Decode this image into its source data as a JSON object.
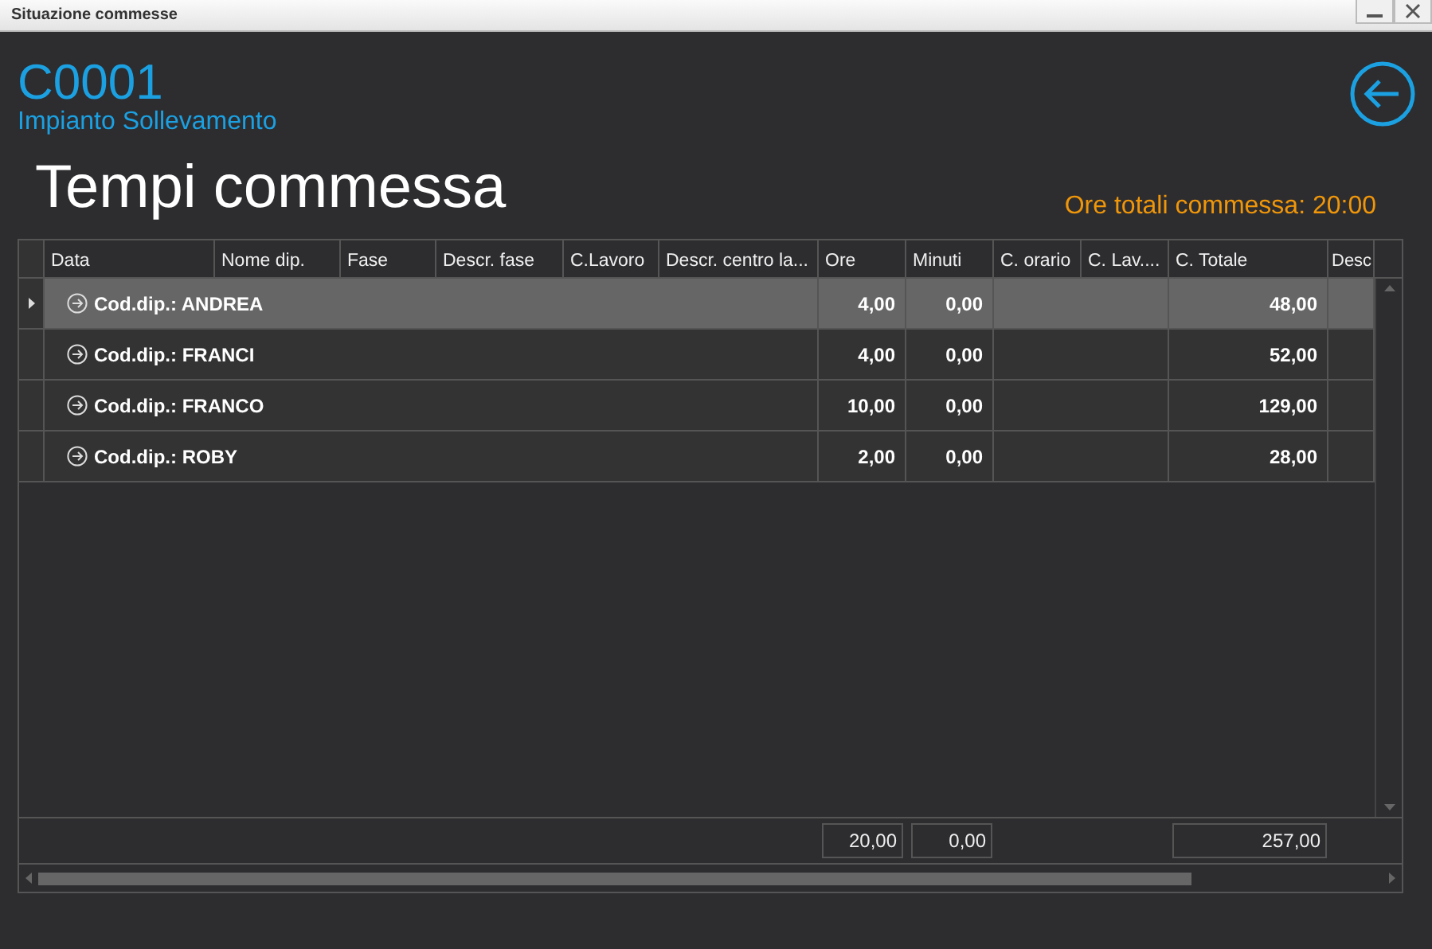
{
  "window": {
    "title": "Situazione commesse"
  },
  "header": {
    "code": "C0001",
    "description": "Impianto Sollevamento"
  },
  "section_title": "Tempi commessa",
  "total_label": "Ore totali commessa: 20:00",
  "table": {
    "columns": [
      "Data",
      "Nome dip.",
      "Fase",
      "Descr. fase",
      "C.Lavoro",
      "Descr. centro la...",
      "Ore",
      "Minuti",
      "C. orario",
      "C. Lav....",
      "C. Totale",
      "Desc"
    ],
    "rows": [
      {
        "label": "Cod.dip.: ANDREA",
        "ore": "4,00",
        "minuti": "0,00",
        "c_totale": "48,00",
        "selected": true
      },
      {
        "label": "Cod.dip.: FRANCI",
        "ore": "4,00",
        "minuti": "0,00",
        "c_totale": "52,00",
        "selected": false
      },
      {
        "label": "Cod.dip.: FRANCO",
        "ore": "10,00",
        "minuti": "0,00",
        "c_totale": "129,00",
        "selected": false
      },
      {
        "label": "Cod.dip.: ROBY",
        "ore": "2,00",
        "minuti": "0,00",
        "c_totale": "28,00",
        "selected": false
      }
    ],
    "totals": {
      "ore": "20,00",
      "minuti": "0,00",
      "c_totale": "257,00"
    }
  }
}
